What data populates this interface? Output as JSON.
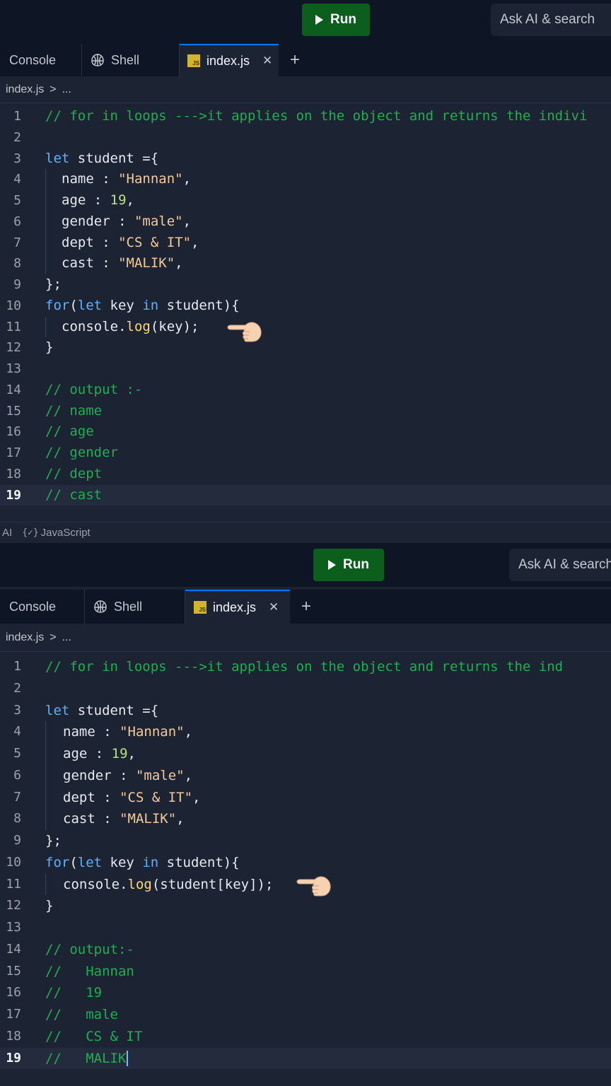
{
  "panels": [
    {
      "run_label": "Run",
      "search_placeholder": "Ask AI & search",
      "tabs": {
        "console": "Console",
        "shell": "Shell",
        "file": "index.js",
        "file_badge": "JS"
      },
      "breadcrumb": {
        "file": "index.js",
        "sep": ">",
        "more": "..."
      },
      "lines": [
        "// for in loops --->it applies on the object and returns the indivi",
        "",
        "let student ={",
        "name : \"Hannan\",",
        "age : 19,",
        "gender : \"male\",",
        "dept : \"CS & IT\",",
        "cast : \"MALIK\",",
        "};",
        "for(let key in student){",
        "console.log(key);",
        "}",
        "",
        "// output :-",
        "// name",
        "// age",
        "// gender",
        "// dept",
        "// cast"
      ],
      "line_numbers": [
        "1",
        "2",
        "3",
        "4",
        "5",
        "6",
        "7",
        "8",
        "9",
        "10",
        "11",
        "12",
        "13",
        "14",
        "15",
        "16",
        "17",
        "18",
        "19"
      ],
      "current_line": 19,
      "status": {
        "ai": "AI",
        "language_icon": "code-braces-icon",
        "language": "JavaScript"
      }
    },
    {
      "run_label": "Run",
      "search_placeholder": "Ask AI & search",
      "tabs": {
        "console": "Console",
        "shell": "Shell",
        "file": "index.js",
        "file_badge": "JS"
      },
      "breadcrumb": {
        "file": "index.js",
        "sep": ">",
        "more": "..."
      },
      "lines": [
        "// for in loops --->it applies on the object and returns the ind",
        "",
        "let student ={",
        "name : \"Hannan\",",
        "age : 19,",
        "gender : \"male\",",
        "dept : \"CS & IT\",",
        "cast : \"MALIK\",",
        "};",
        "for(let key in student){",
        "console.log(student[key]);",
        "}",
        "",
        "// output:-",
        "//   Hannan",
        "//   19",
        "//   male",
        "//   CS & IT",
        "//   MALIK"
      ],
      "line_numbers": [
        "1",
        "2",
        "3",
        "4",
        "5",
        "6",
        "7",
        "8",
        "9",
        "10",
        "11",
        "12",
        "13",
        "14",
        "15",
        "16",
        "17",
        "18",
        "19"
      ],
      "current_line": 19
    }
  ],
  "colors": {
    "background": "#1c2333",
    "topbar": "#0e1525",
    "run_button": "#0b5e1c",
    "active_tab_accent": "#0079f2",
    "comment": "#1faf4e",
    "keyword": "#5fb0ff",
    "string": "#f2c99a",
    "number": "#b9e27a"
  },
  "annotation": "pointing-hand-icon"
}
